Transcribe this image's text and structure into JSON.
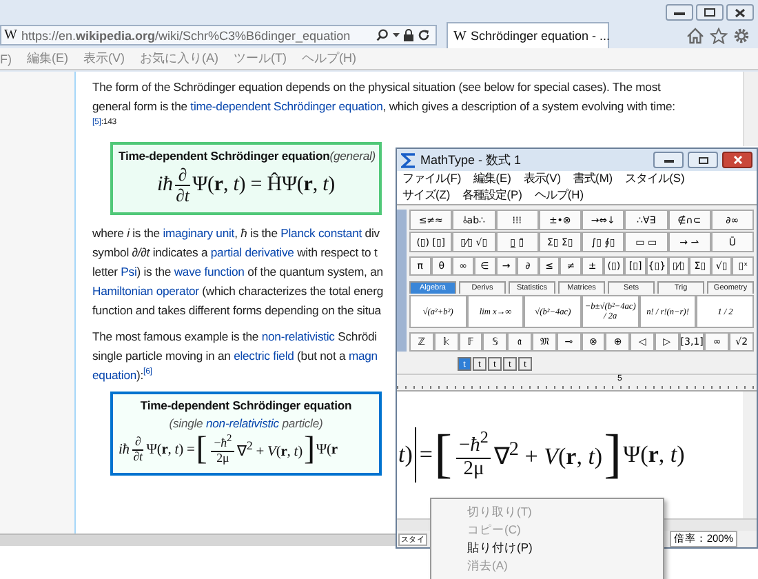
{
  "browser": {
    "address": {
      "favicon": "W",
      "url": "https://en.**wikipedia.org**/wiki/Schr%C3%B6dinger_equation"
    },
    "tab": {
      "favicon": "W",
      "title": "Schrödinger equation - ..."
    },
    "menu": [
      "F)",
      "編集(E)",
      "表示(V)",
      "お気に入り(A)",
      "ツール(T)",
      "ヘルプ(H)"
    ]
  },
  "article": {
    "blocks": [
      {
        "kind": "para",
        "lines": [
          [
            {
              "kind": "text",
              "text": "The form of the Schrödinger equation depends on the physical situation (see below for special cases). The most"
            }
          ],
          [
            {
              "kind": "text",
              "text": "general form is the "
            },
            {
              "kind": "link",
              "text": "time-dependent Schrödinger equation"
            },
            {
              "kind": "text",
              "text": ", which gives a description of a system evolving with time:"
            }
          ],
          [
            {
              "kind": "ref",
              "text": "[5]"
            },
            {
              "kind": "note",
              "text": ":143"
            }
          ]
        ]
      },
      {
        "kind": "box",
        "title": "Time-dependent Schrödinger equation",
        "qualifier": "(general)",
        "equation": [
          {
            "kind": "text",
            "text": "*iħ*"
          },
          {
            "kind": "frac",
            "num": "∂",
            "den": "∂*t*"
          },
          {
            "kind": "text",
            "text": "Ψ(**r**, *t*) = ĤΨ(**r**, *t*)"
          }
        ]
      },
      {
        "kind": "para",
        "lines": [
          [
            {
              "kind": "text",
              "text": "where *i* is the "
            },
            {
              "kind": "link",
              "text": "imaginary unit"
            },
            {
              "kind": "text",
              "text": ", *ħ* is the "
            },
            {
              "kind": "link",
              "text": "Planck constant"
            },
            {
              "kind": "text",
              "text": " div"
            }
          ],
          [
            {
              "kind": "text",
              "text": "symbol *∂/∂t* indicates a "
            },
            {
              "kind": "link",
              "text": "partial derivative"
            },
            {
              "kind": "text",
              "text": " with respect to t"
            }
          ],
          [
            {
              "kind": "text",
              "text": "letter "
            },
            {
              "kind": "link",
              "text": "Psi"
            },
            {
              "kind": "text",
              "text": ") is the "
            },
            {
              "kind": "link",
              "text": "wave function"
            },
            {
              "kind": "text",
              "text": " of the quantum system, an"
            }
          ],
          [
            {
              "kind": "link",
              "text": "Hamiltonian operator"
            },
            {
              "kind": "text",
              "text": " (which characterizes the total energ"
            }
          ],
          [
            {
              "kind": "text",
              "text": "function and takes different forms depending on the situa"
            }
          ]
        ]
      },
      {
        "kind": "para",
        "lines": [
          [
            {
              "kind": "text",
              "text": "The most famous example is the "
            },
            {
              "kind": "link",
              "text": "non-relativistic"
            },
            {
              "kind": "text",
              "text": " Schrödi"
            }
          ],
          [
            {
              "kind": "text",
              "text": "single particle moving in an "
            },
            {
              "kind": "link",
              "text": "electric field"
            },
            {
              "kind": "text",
              "text": " (but not a "
            },
            {
              "kind": "link",
              "text": "magn"
            }
          ],
          [
            {
              "kind": "link",
              "text": "equation"
            },
            {
              "kind": "text",
              "text": "):"
            },
            {
              "kind": "ref",
              "text": "[6]"
            }
          ]
        ]
      },
      {
        "kind": "box",
        "title": "Time-dependent Schrödinger equation",
        "subtitle": [
          {
            "kind": "text",
            "text": "(single "
          },
          {
            "kind": "link",
            "text": "non-relativistic"
          },
          {
            "kind": "text",
            "text": " particle)"
          }
        ],
        "equation": [
          {
            "kind": "text",
            "text": "*iħ*"
          },
          {
            "kind": "frac",
            "num": "∂",
            "den": "∂*t*"
          },
          {
            "kind": "text",
            "text": "Ψ(**r**, *t*) = "
          },
          {
            "kind": "bracket",
            "text": "["
          },
          {
            "kind": "frac",
            "num": "−*ħ*$^{2}$",
            "den": "2μ"
          },
          {
            "kind": "text",
            "text": "∇$^{2}$ + *V*(**r**, *t*)"
          },
          {
            "kind": "bracket",
            "text": "]"
          },
          {
            "kind": "text",
            "text": " Ψ(**r**"
          }
        ]
      }
    ]
  },
  "mathtype": {
    "title": "MathType - 数式 1",
    "menu": [
      [
        "ファイル(F)",
        "編集(E)",
        "表示(V)",
        "書式(M)",
        "スタイル(S)"
      ],
      [
        "サイズ(Z)",
        "各種設定(P)",
        "ヘルプ(H)"
      ]
    ],
    "palette_rows": [
      [
        "≤≠≈",
        "⫰ab∴",
        "⁞⁞⁞",
        "±•⊗",
        "→⇔↓",
        "∴∀∃",
        "∉∩⊂",
        "∂∞"
      ],
      [
        "(▯) [▯]",
        "▯⁄▯ √▯",
        "▯̲ ▯̄",
        "Σ▯ Σ▯",
        "∫▯ ∮▯",
        "▭ ▭",
        "→ ⇀",
        "Ū"
      ],
      [
        "π",
        "θ",
        "∞",
        "∈",
        "→",
        "∂",
        "≤",
        "≠",
        "±",
        "(▯)",
        "[▯]",
        "{▯}",
        "▯⁄▯",
        "Σ▯",
        "√▯",
        "▯ˣ"
      ]
    ],
    "tabs": [
      {
        "label": "Algebra",
        "selected": true
      },
      {
        "label": "Derivs",
        "selected": false
      },
      {
        "label": "Statistics",
        "selected": false
      },
      {
        "label": "Matrices",
        "selected": false
      },
      {
        "label": "Sets",
        "selected": false
      },
      {
        "label": "Trig",
        "selected": false
      },
      {
        "label": "Geometry",
        "selected": false
      }
    ],
    "templates": [
      "√(a²+b²)",
      "lim x→∞",
      "√(b²−4ac)",
      "−b±√(b²−4ac) / 2a",
      "n! / r!(n−r)!",
      "1 / 2"
    ],
    "symbol_row": [
      "ℤ",
      "𝕜",
      "𝔽",
      "𝕊",
      "𝔞",
      "𝔐",
      "⊸",
      "⊗",
      "⊕",
      "◁",
      "▷",
      "[3,1]",
      "∞",
      "√2"
    ],
    "size_tabs": [
      {
        "label": "t",
        "selected": true
      },
      {
        "label": "t",
        "selected": false
      },
      {
        "label": "t",
        "selected": false
      },
      {
        "label": "t",
        "selected": false
      },
      {
        "label": "t",
        "selected": false
      }
    ],
    "ruler_mark": "5",
    "equation": [
      {
        "kind": "text",
        "text": "*t*)"
      },
      {
        "kind": "cursor"
      },
      {
        "kind": "text",
        "text": " = "
      },
      {
        "kind": "bracket",
        "text": "["
      },
      {
        "kind": "frac",
        "num": "−*ħ*$^{2}$",
        "den": "2μ"
      },
      {
        "kind": "text",
        "text": "∇$^{2}$ + *V*(**r**, *t*)"
      },
      {
        "kind": "bracket",
        "text": "]"
      },
      {
        "kind": "text",
        "text": "Ψ(**r**, *t*)"
      }
    ],
    "status": {
      "style": "スタイ",
      "zoom": "倍率：200%"
    }
  },
  "context_menu": [
    {
      "label": "切り取り(T)",
      "disabled": true
    },
    {
      "label": "コピー(C)",
      "disabled": true
    },
    {
      "label": "貼り付け(P)",
      "disabled": false
    },
    {
      "label": "消去(A)",
      "disabled": true
    }
  ]
}
